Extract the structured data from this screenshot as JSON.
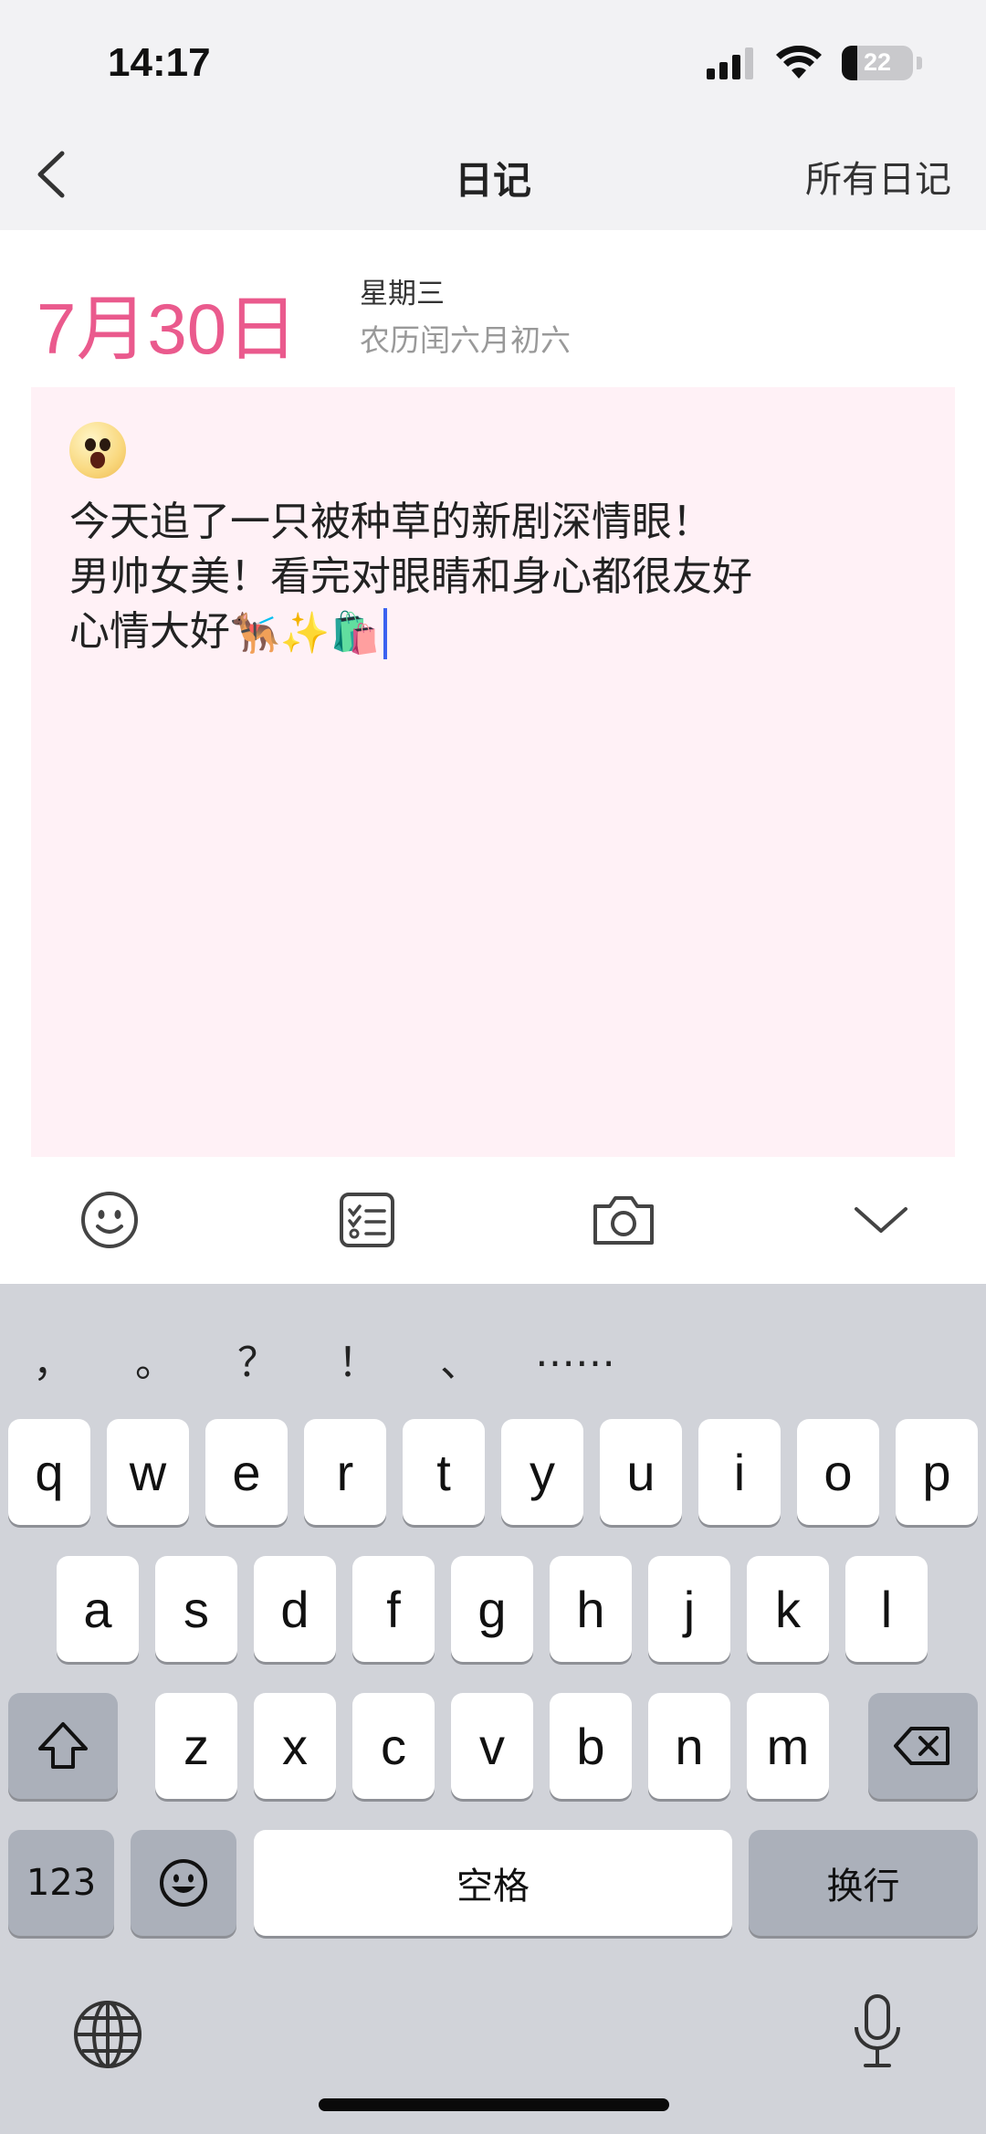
{
  "status_bar": {
    "time": "14:17",
    "battery_level": "22"
  },
  "header": {
    "title": "日记",
    "all_diaries": "所有日记"
  },
  "date": {
    "day": "7月30日",
    "weekday": "星期三",
    "lunar": "农历闰六月初六"
  },
  "entry": {
    "mood_icon": "mood-surprised-face",
    "line1": "今天追了一只被种草的新剧深情眼！",
    "line2": "男帅女美！看完对眼睛和身心都很友好",
    "line3_text": "心情大好",
    "line3_emojis": [
      "🐕‍🦺",
      "✨",
      "🛍️"
    ]
  },
  "toolbar": {
    "icons": [
      "emoji-icon",
      "checklist-icon",
      "camera-icon",
      "collapse-keyboard-icon"
    ]
  },
  "keyboard": {
    "punctuation": [
      "，",
      "。",
      "？",
      "！",
      "、",
      "……"
    ],
    "row1": [
      "q",
      "w",
      "e",
      "r",
      "t",
      "y",
      "u",
      "i",
      "o",
      "p"
    ],
    "row2": [
      "a",
      "s",
      "d",
      "f",
      "g",
      "h",
      "j",
      "k",
      "l"
    ],
    "row3": [
      "z",
      "x",
      "c",
      "v",
      "b",
      "n",
      "m"
    ],
    "numbers_key": "123",
    "space_key": "空格",
    "return_key": "换行"
  },
  "colors": {
    "accent_pink": "#ea5a8d",
    "entry_background": "#fff1f6",
    "cursor": "#3b62f0"
  }
}
